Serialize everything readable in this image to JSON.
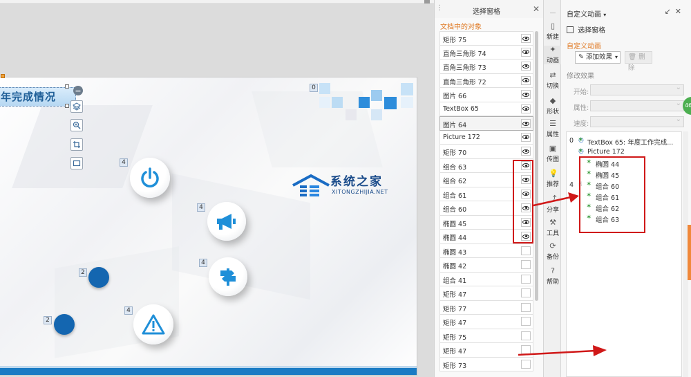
{
  "canvas": {
    "title_text": "年完成情况",
    "anim_badges": [
      "0",
      "4",
      "4",
      "4",
      "4",
      "2",
      "2"
    ],
    "icons": [
      "power-icon",
      "megaphone-icon",
      "signpost-icon",
      "warning-icon"
    ],
    "watermark": {
      "title": "系统之家",
      "subtitle": "XITONGZHIJIA.NET"
    }
  },
  "selection_pane": {
    "title": "选择窗格",
    "section_label": "文档中的对象",
    "items": [
      {
        "name": "矩形 75",
        "visible": true
      },
      {
        "name": "直角三角形 74",
        "visible": true
      },
      {
        "name": "直角三角形 73",
        "visible": true
      },
      {
        "name": "直角三角形 72",
        "visible": true
      },
      {
        "name": "图片 66",
        "visible": true
      },
      {
        "name": "TextBox 65",
        "visible": true
      },
      {
        "name": "图片 64",
        "visible": true,
        "selected": true
      },
      {
        "name": "Picture 172",
        "visible": true
      },
      {
        "name": "矩形 70",
        "visible": true
      },
      {
        "name": "组合 63",
        "visible": true
      },
      {
        "name": "组合 62",
        "visible": true
      },
      {
        "name": "组合 61",
        "visible": true
      },
      {
        "name": "组合 60",
        "visible": true
      },
      {
        "name": "椭圆 45",
        "visible": true
      },
      {
        "name": "椭圆 44",
        "visible": true
      },
      {
        "name": "椭圆 43",
        "visible": false
      },
      {
        "name": "椭圆 42",
        "visible": false
      },
      {
        "name": "组合 41",
        "visible": false
      },
      {
        "name": "矩形 47",
        "visible": false
      },
      {
        "name": "矩形 77",
        "visible": false
      },
      {
        "name": "矩形 47",
        "visible": false
      },
      {
        "name": "矩形 75",
        "visible": false
      },
      {
        "name": "矩形 47",
        "visible": false
      },
      {
        "name": "矩形 73",
        "visible": false
      }
    ]
  },
  "tool_strip": {
    "items": [
      {
        "label": "新建",
        "icon": "new-doc-icon"
      },
      {
        "label": "动画",
        "icon": "animation-icon"
      },
      {
        "label": "切换",
        "icon": "transition-icon"
      },
      {
        "label": "形状",
        "icon": "shape-icon"
      },
      {
        "label": "属性",
        "icon": "property-icon"
      },
      {
        "label": "传图",
        "icon": "image-upload-icon"
      },
      {
        "label": "推荐",
        "icon": "lightbulb-icon"
      },
      {
        "label": "分享",
        "icon": "share-icon"
      },
      {
        "label": "工具",
        "icon": "toolbox-icon"
      },
      {
        "label": "备份",
        "icon": "backup-icon"
      },
      {
        "label": "帮助",
        "icon": "help-icon"
      }
    ]
  },
  "anim_pane": {
    "title": "自定义动画",
    "selection_pane_link": "选择窗格",
    "section_label": "自定义动画",
    "add_effect": "添加效果",
    "delete": "删除",
    "modify_label": "修改效果",
    "fields": [
      {
        "label": "开始:"
      },
      {
        "label": "属性:"
      },
      {
        "label": "速度:"
      }
    ],
    "list": [
      {
        "index": "0",
        "label": "TextBox 65: 年度工作完成..."
      },
      {
        "index": "",
        "label": "Picture 172"
      },
      {
        "index": "",
        "label": "椭圆 44"
      },
      {
        "index": "",
        "label": "椭圆 45"
      },
      {
        "index": "4",
        "label": "组合 60"
      },
      {
        "index": "",
        "label": "组合 61"
      },
      {
        "index": "",
        "label": "组合 62"
      },
      {
        "index": "",
        "label": "组合 63"
      }
    ],
    "badge_text": "46"
  },
  "colors": {
    "accent_orange": "#e07b26",
    "annotation_red": "#d01818",
    "slide_blue": "#1466b0"
  }
}
